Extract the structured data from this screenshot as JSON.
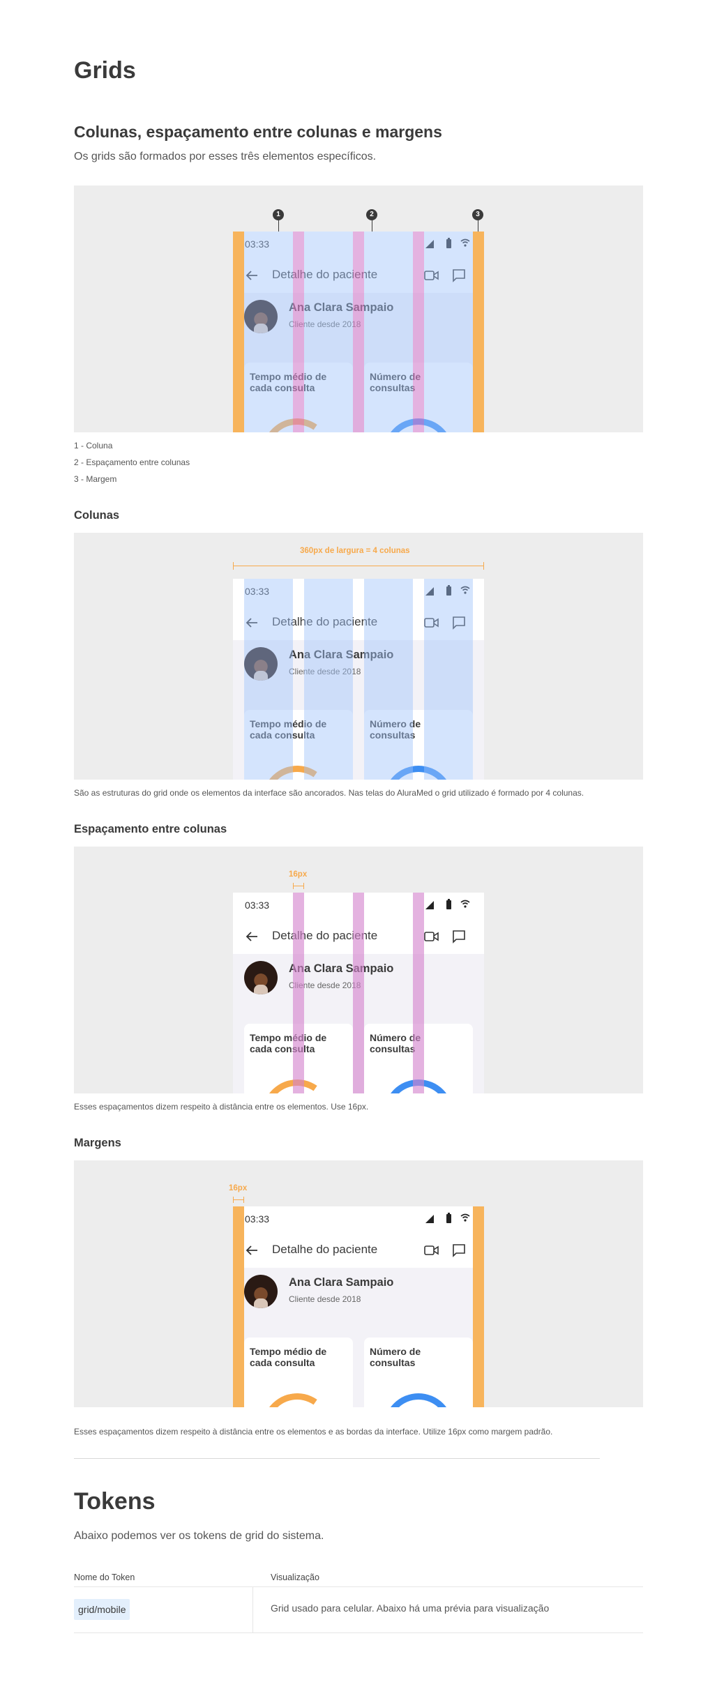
{
  "page": {
    "title": "Grids",
    "intro_heading": "Colunas, espaçamento entre colunas e margens",
    "intro_text": "Os grids são formados por esses três elementos específicos."
  },
  "legend": [
    "1 - Coluna",
    "2 - Espaçamento entre colunas",
    "3 - Margem"
  ],
  "markers": [
    "1",
    "2",
    "3"
  ],
  "phone": {
    "time": "03:33",
    "appbar_title": "Detalhe do paciente",
    "patient_name": "Ana Clara Sampaio",
    "patient_since": "Cliente desde 2018",
    "card1_title": "Tempo médio de cada consulta",
    "card2_title": "Número de consultas",
    "icons": [
      "signal-icon",
      "battery-icon",
      "wifi-icon",
      "back-arrow-icon",
      "video-icon",
      "chat-icon"
    ]
  },
  "sections": {
    "columns": {
      "title": "Colunas",
      "dimension_label": "360px de largura = 4 colunas",
      "caption": "São as estruturas do grid onde os elementos da interface são ancorados. Nas telas do AluraMed o grid utilizado é formado por 4 colunas."
    },
    "gutters": {
      "title": "Espaçamento entre colunas",
      "dimension_label": "16px",
      "caption": "Esses espaçamentos dizem respeito à distância entre os elementos. Use 16px."
    },
    "margins": {
      "title": "Margens",
      "dimension_label": "16px",
      "caption": "Esses espaçamentos dizem respeito à distância entre os elementos e as bordas da interface. Utilize 16px como margem padrão."
    }
  },
  "tokens": {
    "title": "Tokens",
    "intro": "Abaixo podemos ver os tokens de grid do sistema.",
    "headers": [
      "Nome do Token",
      "Visualização"
    ],
    "rows": [
      {
        "name": "grid/mobile",
        "description": "Grid usado para celular. Abaixo há uma prévia para visualização"
      }
    ]
  },
  "colors": {
    "column": "#a0c3fa",
    "gutter": "#d482cd",
    "margin": "#f7b45c",
    "gauge_orange": "#f7a94b",
    "gauge_blue": "#3d8ef2",
    "panel": "#ededed"
  }
}
